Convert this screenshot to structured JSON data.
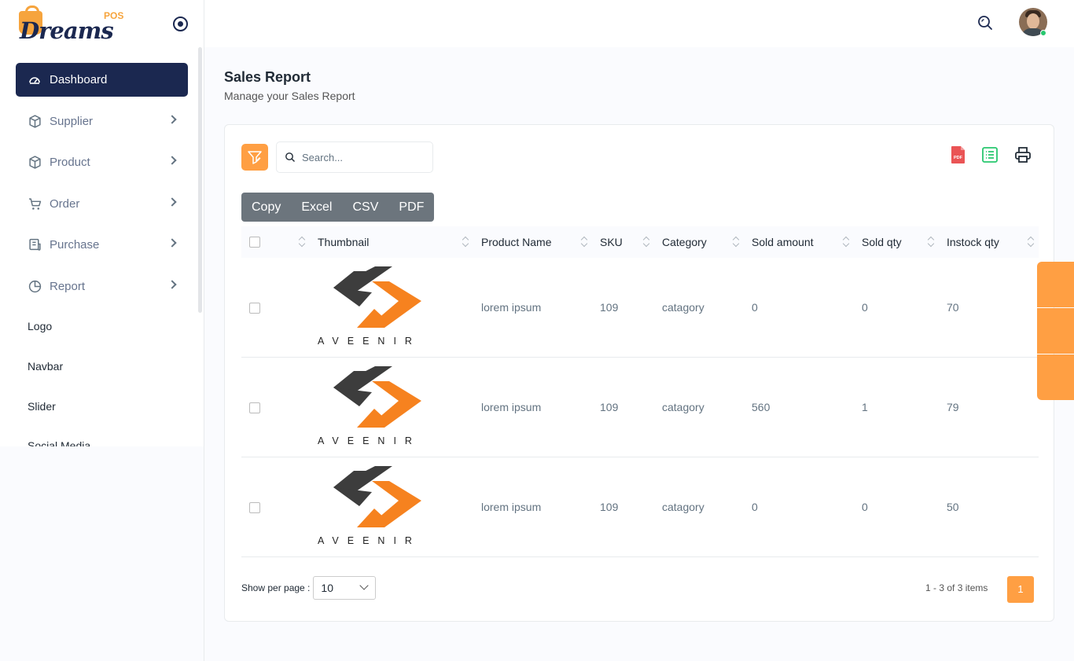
{
  "brand": {
    "word": "Dreams",
    "suffix": "POS"
  },
  "sidebar": {
    "menu": [
      {
        "label": "Dashboard",
        "icon": "dashboard-icon",
        "active": true
      },
      {
        "label": "Supplier",
        "icon": "box-icon"
      },
      {
        "label": "Product",
        "icon": "box-icon"
      },
      {
        "label": "Order",
        "icon": "cart-icon"
      },
      {
        "label": "Purchase",
        "icon": "receipt-icon"
      },
      {
        "label": "Report",
        "icon": "pie-chart-icon"
      }
    ],
    "plain_items": [
      "Logo",
      "Navbar",
      "Slider",
      "Social Media"
    ]
  },
  "page": {
    "title": "Sales Report",
    "subtitle": "Manage your Sales Report"
  },
  "search": {
    "placeholder": "Search..."
  },
  "export_buttons": [
    "Copy",
    "Excel",
    "CSV",
    "PDF"
  ],
  "table": {
    "columns": [
      "Thumbnail",
      "Product Name",
      "SKU",
      "Category",
      "Sold amount",
      "Sold qty",
      "Instock qty"
    ],
    "thumbnail_text": "AVEENIR",
    "rows": [
      {
        "name": "lorem ipsum",
        "sku": "109",
        "category": "catagory",
        "sold_amount": "0",
        "sold_qty": "0",
        "instock": "70"
      },
      {
        "name": "lorem ipsum",
        "sku": "109",
        "category": "catagory",
        "sold_amount": "560",
        "sold_qty": "1",
        "instock": "79"
      },
      {
        "name": "lorem ipsum",
        "sku": "109",
        "category": "catagory",
        "sold_amount": "0",
        "sold_qty": "0",
        "instock": "50"
      }
    ]
  },
  "pagination": {
    "per_page_label": "Show per page :",
    "per_page_value": "10",
    "range": "1 - 3 of 3 items",
    "current_page": "1"
  },
  "colors": {
    "primary": "#ff9f43",
    "navy": "#1b2850",
    "pdf": "#ea5455",
    "excel": "#28c76f"
  }
}
